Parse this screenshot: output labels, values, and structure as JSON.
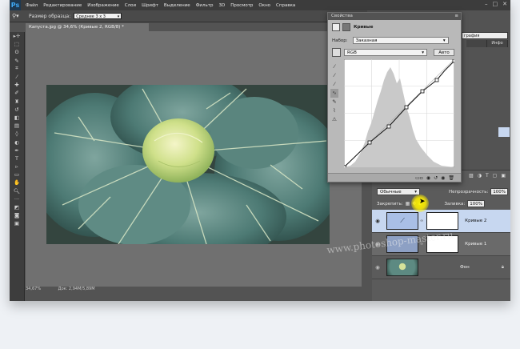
{
  "menubar": {
    "logo": "Ps",
    "items": [
      "Файл",
      "Редактирование",
      "Изображение",
      "Слои",
      "Шрифт",
      "Выделение",
      "Фильтр",
      "3D",
      "Просмотр",
      "Окно",
      "Справка"
    ]
  },
  "optionsbar": {
    "sample_size_label": "Размер образца:",
    "sample_size_value": "Среднее 3 x 3"
  },
  "document": {
    "tab_title": "Капуста.jpg @ 34,6% (Кривые 2, RGB/8) *",
    "status_zoom": "34,67%",
    "status_doc": "Док: 2,94M/5,89M"
  },
  "properties": {
    "title": "Свойства",
    "adjustment_name": "Кривые",
    "preset_label": "Набор:",
    "preset_value": "Заказная",
    "channel_value": "RGB",
    "auto_button": "Авто"
  },
  "rightpanel": {
    "workspace_field": "графия",
    "tabs": [
      "",
      "Инфо"
    ]
  },
  "layers": {
    "blend_mode": "Обычные",
    "opacity_label": "Непрозрачность:",
    "opacity_value": "100%",
    "lock_label": "Закрепить:",
    "fill_label": "Заливка:",
    "fill_value": "100%",
    "items": [
      {
        "name": "Кривые 2",
        "selected": true
      },
      {
        "name": "Кривые 1",
        "selected": false
      },
      {
        "name": "Фон",
        "selected": false
      }
    ]
  },
  "watermark": "www.photoshop-master.ru",
  "colors": {
    "accent": "#3fa9f5",
    "selection": "#c7d7f0",
    "cursor_highlight": "#fff000"
  },
  "icons": {
    "eyedropper": "eyedropper-icon",
    "curve_pencil": "pencil-icon",
    "visibility": "eye-icon",
    "lock": "lock-icon"
  }
}
